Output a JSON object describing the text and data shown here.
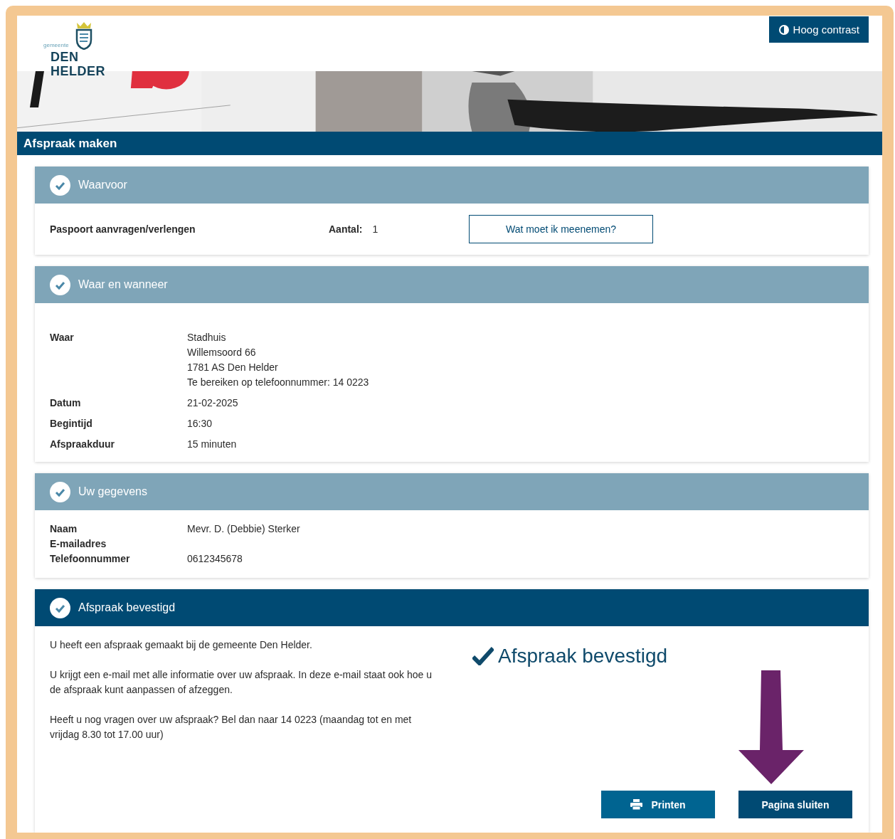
{
  "header": {
    "logo_small": "gemeente",
    "logo_name": "DEN HELDER",
    "contrast_button": "Hoog contrast"
  },
  "page_title": "Afspraak maken",
  "sections": [
    {
      "title": "Waarvoor",
      "kind": "done",
      "service": {
        "name": "Paspoort aanvragen/verlengen",
        "count_label": "Aantal:",
        "count": "1",
        "button": "Wat moet ik meenemen?"
      }
    },
    {
      "title": "Waar en wanneer",
      "kind": "done",
      "rows": [
        {
          "label": "Waar",
          "lines": [
            "Stadhuis",
            "Willemsoord 66",
            "1781 AS Den Helder",
            "Te bereiken op telefoonnummer: 14 0223"
          ]
        },
        {
          "label": "Datum",
          "lines": [
            "21-02-2025"
          ]
        },
        {
          "label": "Begintijd",
          "lines": [
            "16:30"
          ]
        },
        {
          "label": "Afspraakduur",
          "lines": [
            "15 minuten"
          ]
        }
      ]
    },
    {
      "title": "Uw gegevens",
      "kind": "done",
      "rows": [
        {
          "label": "Naam",
          "lines": [
            "Mevr. D. (Debbie) Sterker"
          ]
        },
        {
          "label": "E-mailadres"
        },
        {
          "label": "Telefoonnummer",
          "lines": [
            "0612345678"
          ]
        }
      ]
    },
    {
      "title": "Afspraak bevestigd",
      "kind": "current",
      "paragraphs": [
        "U heeft een afspraak gemaakt bij de gemeente Den Helder.",
        "U krijgt een e-mail met alle informatie over uw afspraak. In deze e-mail staat ook hoe u de afspraak kunt aanpassen of afzeggen.",
        "Heeft u nog vragen over uw afspraak? Bel dan naar 14 0223 (maandag tot en met vrijdag 8.30 tot 17.00 uur)"
      ],
      "confirmation": "Afspraak bevestigd",
      "pointer_arrow": true,
      "buttons": [
        {
          "label": "Printen",
          "kind": "print"
        },
        {
          "label": "Pagina sluiten",
          "kind": "close"
        }
      ]
    }
  ]
}
